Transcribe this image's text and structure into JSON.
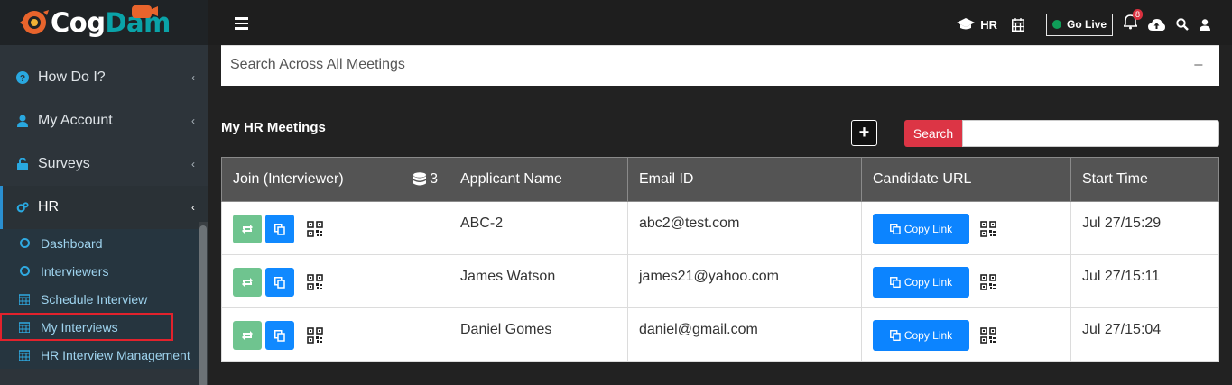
{
  "logo": {
    "part1": "Cog",
    "part2": "Dam"
  },
  "sidebar": {
    "items": [
      {
        "label": "How Do I?",
        "icon": "question-circle-icon"
      },
      {
        "label": "My Account",
        "icon": "user-icon"
      },
      {
        "label": "Surveys",
        "icon": "unlock-icon"
      },
      {
        "label": "HR",
        "icon": "gears-icon"
      }
    ],
    "sub_items": [
      {
        "label": "Dashboard",
        "icon": "circle-icon"
      },
      {
        "label": "Interviewers",
        "icon": "circle-icon"
      },
      {
        "label": "Schedule Interview",
        "icon": "calendar-icon"
      },
      {
        "label": "My Interviews",
        "icon": "calendar-icon"
      },
      {
        "label": "HR Interview Management",
        "icon": "calendar-icon"
      }
    ]
  },
  "topbar": {
    "hr_label": "HR",
    "go_live": "Go Live",
    "notification_count": "8"
  },
  "search_panel": {
    "title": "Search Across All Meetings"
  },
  "section_title": "My HR Meetings",
  "search_button": "Search",
  "table": {
    "headers": [
      "Join (Interviewer)",
      "Applicant Name",
      "Email ID",
      "Candidate URL",
      "Start Time"
    ],
    "count": "3",
    "copy_label": "Copy Link",
    "rows": [
      {
        "name": "ABC-2",
        "email": "abc2@test.com",
        "time": "Jul 27/15:29"
      },
      {
        "name": "James Watson",
        "email": "james21@yahoo.com",
        "time": "Jul 27/15:11"
      },
      {
        "name": "Daniel Gomes",
        "email": "daniel@gmail.com",
        "time": "Jul 27/15:04"
      }
    ]
  },
  "colors": {
    "accent": "#1089ff",
    "danger": "#dc3545",
    "green": "#6fc48f",
    "sidebar": "#2d343a"
  }
}
